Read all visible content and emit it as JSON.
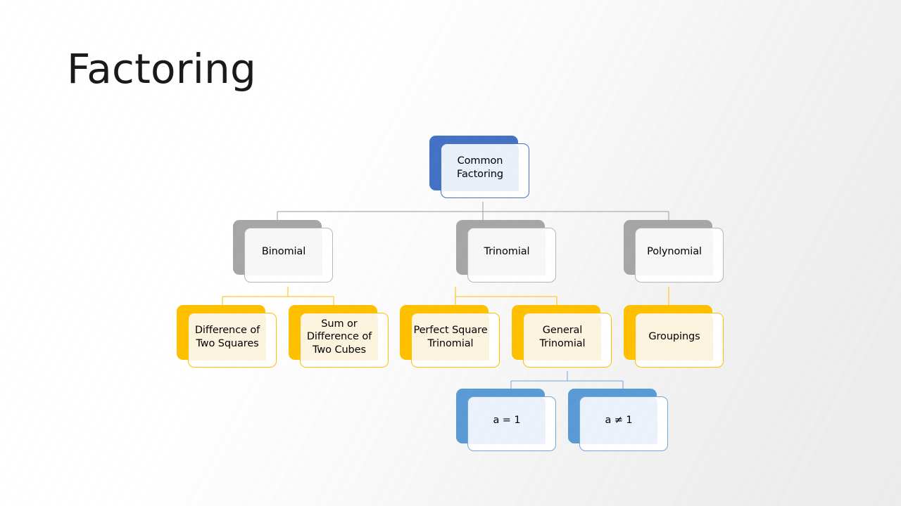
{
  "slide": {
    "title": "Factoring",
    "background_from": "#ffffff",
    "background_to": "#ececec"
  },
  "palette": {
    "root_accent": "#4472C4",
    "level2_accent": "#A6A6A6",
    "level3_accent": "#FFC000",
    "leaf_accent": "#5B9BD5",
    "connector_gray": "#9A9A9A",
    "connector_gold": "#FFC000",
    "connector_blue": "#6FA8DC",
    "text": "#000000"
  },
  "diagram": {
    "type": "hierarchy",
    "root": {
      "id": "common-factoring",
      "label": "Common\nFactoring",
      "style": "blue-dark"
    },
    "level2": [
      {
        "id": "binomial",
        "label": "Binomial",
        "style": "gray"
      },
      {
        "id": "trinomial",
        "label": "Trinomial",
        "style": "gray"
      },
      {
        "id": "polynomial",
        "label": "Polynomial",
        "style": "gray"
      }
    ],
    "level3": [
      {
        "id": "difference-two-squares",
        "label": "Difference of\nTwo Squares",
        "style": "gold",
        "parent": "binomial"
      },
      {
        "id": "sum-difference-cubes",
        "label": "Sum or\nDifference of\nTwo Cubes",
        "style": "gold",
        "parent": "binomial"
      },
      {
        "id": "perfect-square-trinomial",
        "label": "Perfect Square\nTrinomial",
        "style": "gold",
        "parent": "trinomial"
      },
      {
        "id": "general-trinomial",
        "label": "General\nTrinomial",
        "style": "gold",
        "parent": "trinomial"
      },
      {
        "id": "groupings",
        "label": "Groupings",
        "style": "gold",
        "parent": "polynomial"
      }
    ],
    "level4": [
      {
        "id": "a-equals-1",
        "label": "a = 1",
        "style": "blue-light",
        "parent": "general-trinomial"
      },
      {
        "id": "a-not-equals-1",
        "label": "a  ≠ 1",
        "style": "blue-light",
        "parent": "general-trinomial"
      }
    ]
  }
}
